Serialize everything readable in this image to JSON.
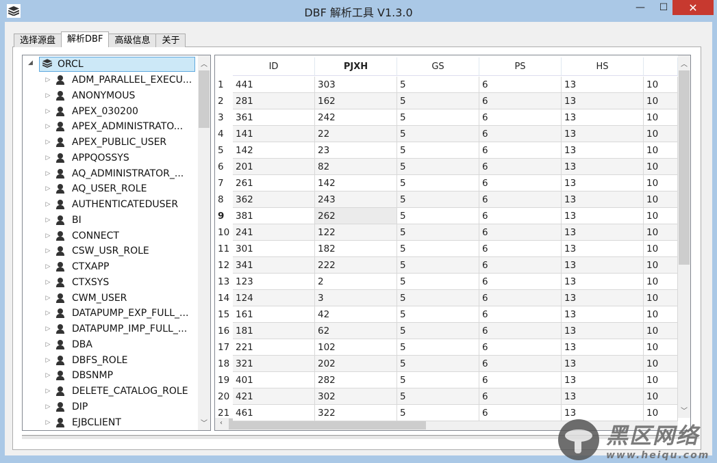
{
  "window": {
    "title": "DBF 解析工具  V1.3.0",
    "minimize": "—",
    "maximize": "☐",
    "close": "✕"
  },
  "tabs": [
    {
      "label": "选择源盘"
    },
    {
      "label": "解析DBF"
    },
    {
      "label": "高级信息"
    },
    {
      "label": "关于"
    }
  ],
  "active_tab": 1,
  "tree": {
    "root": "ORCL",
    "items": [
      "ADM_PARALLEL_EXECU...",
      "ANONYMOUS",
      "APEX_030200",
      "APEX_ADMINISTRATO...",
      "APEX_PUBLIC_USER",
      "APPQOSSYS",
      "AQ_ADMINISTRATOR_...",
      "AQ_USER_ROLE",
      "AUTHENTICATEDUSER",
      "BI",
      "CONNECT",
      "CSW_USR_ROLE",
      "CTXAPP",
      "CTXSYS",
      "CWM_USER",
      "DATAPUMP_EXP_FULL_...",
      "DATAPUMP_IMP_FULL_...",
      "DBA",
      "DBFS_ROLE",
      "DBSNMP",
      "DELETE_CATALOG_ROLE",
      "DIP",
      "EJBCLIENT"
    ]
  },
  "grid": {
    "columns": [
      "ID",
      "PJXH",
      "GS",
      "PS",
      "HS",
      ""
    ],
    "rows": [
      [
        "441",
        "303",
        "5",
        "6",
        "13",
        "10"
      ],
      [
        "281",
        "162",
        "5",
        "6",
        "13",
        "10"
      ],
      [
        "361",
        "242",
        "5",
        "6",
        "13",
        "10"
      ],
      [
        "141",
        "22",
        "5",
        "6",
        "13",
        "10"
      ],
      [
        "142",
        "23",
        "5",
        "6",
        "13",
        "10"
      ],
      [
        "201",
        "82",
        "5",
        "6",
        "13",
        "10"
      ],
      [
        "261",
        "142",
        "5",
        "6",
        "13",
        "10"
      ],
      [
        "362",
        "243",
        "5",
        "6",
        "13",
        "10"
      ],
      [
        "381",
        "262",
        "5",
        "6",
        "13",
        "10"
      ],
      [
        "241",
        "122",
        "5",
        "6",
        "13",
        "10"
      ],
      [
        "301",
        "182",
        "5",
        "6",
        "13",
        "10"
      ],
      [
        "341",
        "222",
        "5",
        "6",
        "13",
        "10"
      ],
      [
        "123",
        "2",
        "5",
        "6",
        "13",
        "10"
      ],
      [
        "124",
        "3",
        "5",
        "6",
        "13",
        "10"
      ],
      [
        "161",
        "42",
        "5",
        "6",
        "13",
        "10"
      ],
      [
        "181",
        "62",
        "5",
        "6",
        "13",
        "10"
      ],
      [
        "221",
        "102",
        "5",
        "6",
        "13",
        "10"
      ],
      [
        "321",
        "202",
        "5",
        "6",
        "13",
        "10"
      ],
      [
        "401",
        "282",
        "5",
        "6",
        "13",
        "10"
      ],
      [
        "421",
        "302",
        "5",
        "6",
        "13",
        "10"
      ],
      [
        "461",
        "322",
        "5",
        "6",
        "13",
        "10"
      ]
    ],
    "selected_row": 9,
    "selected_column": "PJXH"
  },
  "watermark": {
    "cn": "黑区网络",
    "url": "www.heiqu.com"
  }
}
